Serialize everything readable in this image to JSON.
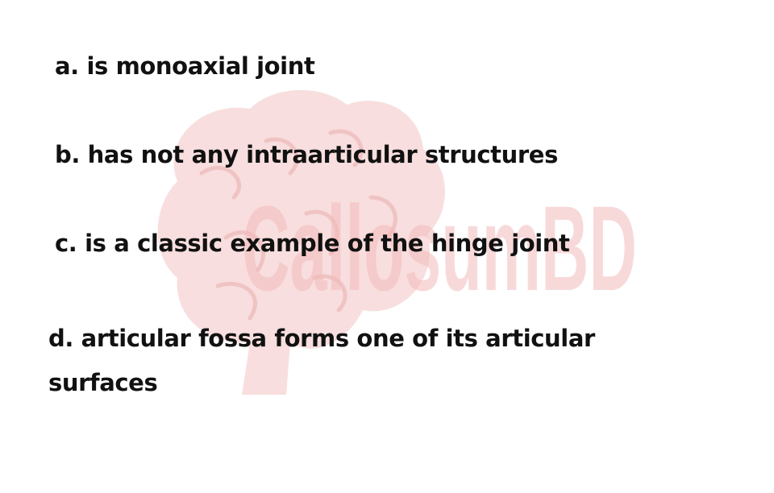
{
  "options": [
    {
      "text": "a. is monoaxial joint"
    },
    {
      "text": "b. has not any intraarticular structures"
    },
    {
      "text": "c. is a classic example of the hinge joint"
    },
    {
      "text": "d. articular fossa forms one of its articular surfaces"
    }
  ],
  "watermark": {
    "text": "CallosumBD",
    "icon": "brain-icon",
    "color": "#f6c8c8"
  }
}
